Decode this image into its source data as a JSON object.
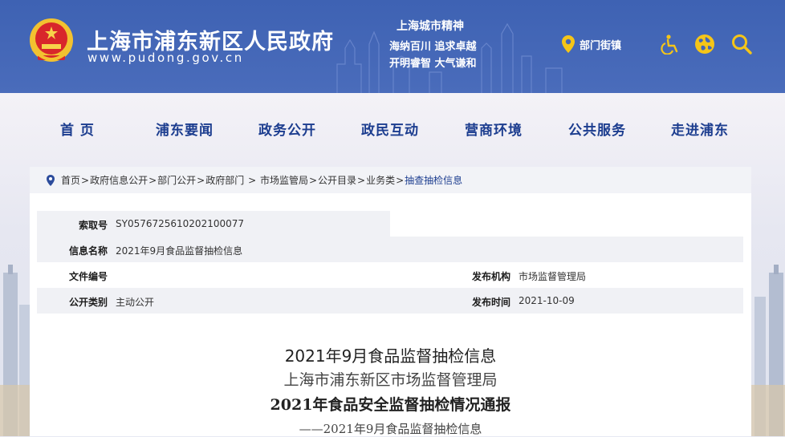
{
  "header": {
    "site_title": "上海市浦东新区人民政府",
    "site_url": "www.pudong.gov.cn",
    "spirit_title": "上海城市精神",
    "spirit_line1": "海纳百川  追求卓越",
    "spirit_line2": "开明睿智  大气谦和",
    "dept_link": "部门街镇",
    "icons": [
      "location-pin-icon",
      "accessibility-icon",
      "globe-icon",
      "search-icon"
    ]
  },
  "nav": {
    "items": [
      "首 页",
      "浦东要闻",
      "政务公开",
      "政民互动",
      "营商环境",
      "公共服务",
      "走进浦东"
    ]
  },
  "breadcrumb": {
    "items": [
      "首页",
      "政府信息公开",
      "部门公开",
      "政府部门 ",
      " 市场监管局",
      "公开目录",
      "业务类",
      "抽查抽检信息"
    ]
  },
  "info": {
    "index_label": "索取号",
    "index_value": "SY0576725610202100077",
    "name_label": "信息名称",
    "name_value": "2021年9月食品监督抽检信息",
    "doc_label": "文件编号",
    "doc_value": "",
    "org_label": "发布机构",
    "org_value": "市场监督管理局",
    "type_label": "公开类别",
    "type_value": "主动公开",
    "date_label": "发布时间",
    "date_value": "2021-10-09"
  },
  "article": {
    "title": "2021年9月食品监督抽检信息",
    "subtitle1": "上海市浦东新区市场监督管理局",
    "subtitle2": "2021年食品安全监督抽检情况通报",
    "subtitle3": "——2021年9月食品监督抽检信息"
  },
  "colors": {
    "header_blue": "#4466b6",
    "nav_text": "#1c3d8f",
    "accent_yellow": "#f5c518"
  }
}
